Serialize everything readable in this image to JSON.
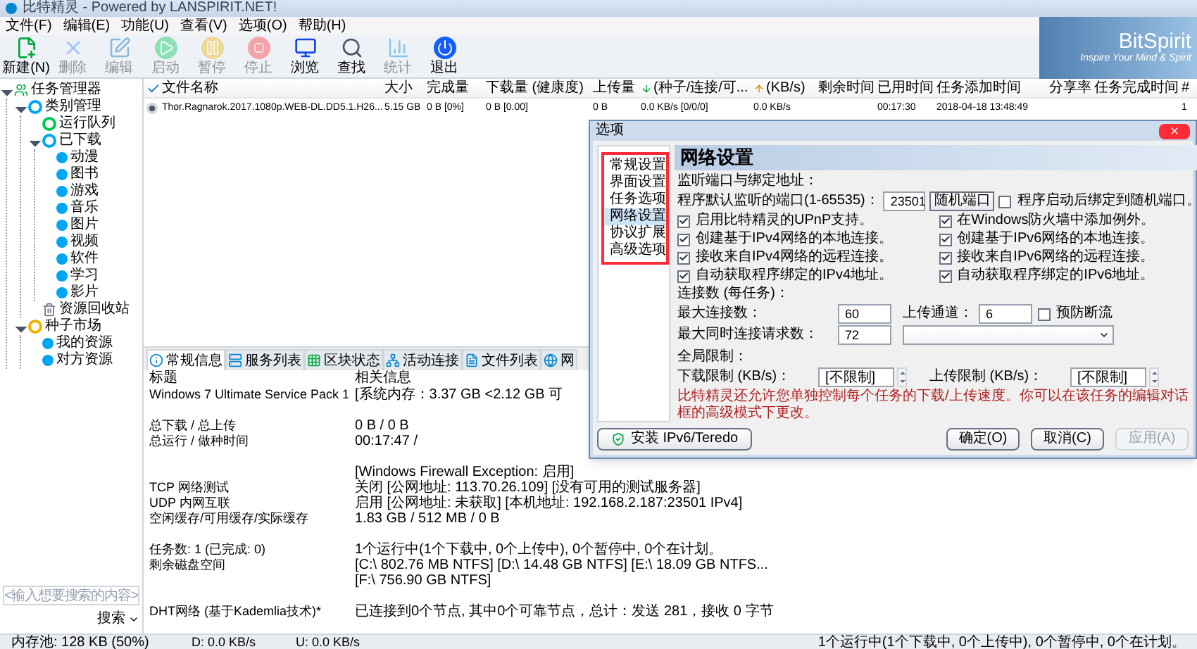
{
  "window": {
    "title": "比特精灵 - Powered by LANSPIRIT.NET!"
  },
  "menu": [
    "文件(F)",
    "编辑(E)",
    "功能(U)",
    "查看(V)",
    "选项(O)",
    "帮助(H)"
  ],
  "toolbar": [
    {
      "label": "新建(N)",
      "kind": "new",
      "disabled": false
    },
    {
      "label": "删除",
      "kind": "delete",
      "disabled": true
    },
    {
      "label": "编辑",
      "kind": "edit",
      "disabled": true
    },
    {
      "label": "启动",
      "kind": "start",
      "disabled": true
    },
    {
      "label": "暂停",
      "kind": "pause",
      "disabled": true
    },
    {
      "label": "停止",
      "kind": "stop",
      "disabled": true
    },
    {
      "label": "浏览",
      "kind": "browse",
      "disabled": false
    },
    {
      "label": "查找",
      "kind": "find",
      "disabled": false
    },
    {
      "label": "统计",
      "kind": "stats",
      "disabled": true
    },
    {
      "label": "退出",
      "kind": "exit",
      "disabled": false
    }
  ],
  "logo": {
    "name": "BitSpirit",
    "tagline": "Inspire Your Mind & Spirit"
  },
  "sidebar": {
    "tree": [
      {
        "label": "任务管理器",
        "kind": "manager",
        "expanded": true,
        "children": [
          {
            "label": "类别管理",
            "kind": "category",
            "expanded": true,
            "children": [
              {
                "label": "运行队列",
                "kind": "queue"
              },
              {
                "label": "已下载",
                "kind": "category",
                "expanded": true,
                "children": [
                  {
                    "label": "动漫",
                    "kind": "item"
                  },
                  {
                    "label": "图书",
                    "kind": "item"
                  },
                  {
                    "label": "游戏",
                    "kind": "item"
                  },
                  {
                    "label": "音乐",
                    "kind": "item"
                  },
                  {
                    "label": "图片",
                    "kind": "item"
                  },
                  {
                    "label": "视频",
                    "kind": "item"
                  },
                  {
                    "label": "软件",
                    "kind": "item"
                  },
                  {
                    "label": "学习",
                    "kind": "item"
                  },
                  {
                    "label": "影片",
                    "kind": "item"
                  }
                ]
              },
              {
                "label": "资源回收站",
                "kind": "recycle"
              }
            ]
          },
          {
            "label": "种子市场",
            "kind": "market",
            "expanded": true,
            "children": [
              {
                "label": "我的资源",
                "kind": "item"
              },
              {
                "label": "对方资源",
                "kind": "item"
              }
            ]
          }
        ]
      }
    ],
    "search": {
      "placeholder": "<输入想要搜索的内容>"
    },
    "search_button": "搜索"
  },
  "table": {
    "columns": [
      {
        "kind": "check"
      },
      {
        "label": "文件名称"
      },
      {
        "label": "大小"
      },
      {
        "label": "完成量"
      },
      {
        "label": "下载量 (健康度)"
      },
      {
        "label": "上传量"
      },
      {
        "label": "(种子/连接/可...",
        "kind": "down"
      },
      {
        "label": "(KB/s)",
        "kind": "up"
      },
      {
        "label": "剩余时间"
      },
      {
        "label": "已用时间"
      },
      {
        "label": "任务添加时间"
      },
      {
        "label": "分享率"
      },
      {
        "label": "任务完成时间"
      },
      {
        "label": "#"
      }
    ],
    "rows": [
      {
        "cells": [
          "",
          "Thor.Ragnarok.2017.1080p.WEB-DL.DD5.1.H26...",
          "5.15 GB",
          "0 B [0%]",
          "0 B [0.00]",
          "0 B",
          "0.0 KB/s [0/0/0]",
          "0.0 KB/s",
          null,
          "00:17:30",
          "2018-04-18 13:48:49",
          null,
          null,
          "1"
        ]
      }
    ]
  },
  "bottom_tabs": [
    {
      "label": "常规信息",
      "kind": "info",
      "selected": true
    },
    {
      "label": "服务列表",
      "kind": "server",
      "selected": false
    },
    {
      "label": "区块状态",
      "kind": "blocks",
      "selected": false
    },
    {
      "label": "活动连接",
      "kind": "network",
      "selected": false
    },
    {
      "label": "文件列表",
      "kind": "files",
      "selected": false
    },
    {
      "label": "网",
      "kind": "web",
      "selected": false
    }
  ],
  "info": {
    "columns": [
      "标题",
      "相关信息"
    ],
    "groups": [
      [
        {
          "label": "Windows 7 Ultimate Service Pack 1",
          "value": "[系统内存：3.37 GB <2.12 GB 可"
        }
      ],
      [
        {
          "label": "总下载 / 总上传",
          "value": "0 B / 0 B"
        },
        {
          "label": "总运行 / 做种时间",
          "value": "00:17:47 /"
        }
      ],
      [
        {
          "value": "[Windows Firewall Exception: 启用]"
        },
        {
          "label": "TCP 网络测试",
          "value": "关闭 [公网地址: 113.70.26.109] [没有可用的测试服务器]"
        },
        {
          "label": "UDP 内网互联",
          "value": "启用 [公网地址: 未获取] [本机地址: 192.168.2.187:23501 IPv4]"
        },
        {
          "label": "空闲缓存/可用缓存/实际缓存",
          "value": "1.83 GB / 512 MB / 0 B"
        }
      ],
      [
        {
          "label": "任务数: 1 (已完成: 0)",
          "value": "1个运行中(1个下载中, 0个上传中), 0个暂停中, 0个在计划。"
        },
        {
          "label": "剩余磁盘空间",
          "value": "[C:\\ 802.76 MB  NTFS]  [D:\\ 14.48 GB  NTFS]  [E:\\ 18.09 GB  NTFS..."
        },
        {
          "value": "[F:\\ 756.90 GB  NTFS]"
        }
      ],
      [
        {
          "label": "DHT网络 (基于Kademlia技术)*",
          "value": "已连接到0个节点, 其中0个可靠节点，总计：发送 281，接收 0 字节"
        }
      ]
    ]
  },
  "dialog": {
    "title": "选项",
    "nav": [
      {
        "label": "常规设置",
        "selected": false
      },
      {
        "label": "界面设置",
        "selected": false
      },
      {
        "label": "任务选项",
        "selected": false
      },
      {
        "label": "网络设置",
        "selected": true
      },
      {
        "label": "协议扩展",
        "selected": false
      },
      {
        "label": "高级选项",
        "selected": false
      }
    ],
    "heading": "网络设置",
    "listen_section": "监听端口与绑定地址：",
    "port_label": "程序默认监听的端口(1-65535)：",
    "port": "23501",
    "random_port_button": "随机端口",
    "random_on_start": {
      "label": "程序启动后绑定到随机端口。",
      "checked": false
    },
    "options": [
      {
        "label": "启用比特精灵的UPnP支持。",
        "checked": true
      },
      {
        "label": "在Windows防火墙中添加例外。",
        "checked": true
      },
      {
        "label": "创建基于IPv4网络的本地连接。",
        "checked": true
      },
      {
        "label": "创建基于IPv6网络的本地连接。",
        "checked": true
      },
      {
        "label": "接收来自IPv4网络的远程连接。",
        "checked": true
      },
      {
        "label": "接收来自IPv6网络的远程连接。",
        "checked": true
      },
      {
        "label": "自动获取程序绑定的IPv4地址。",
        "checked": true
      },
      {
        "label": "自动获取程序绑定的IPv6地址。",
        "checked": true
      }
    ],
    "conn_section": "连接数 (每任务)：",
    "max_conn_label": "最大连接数：",
    "max_conn": "60",
    "upload_slots_label": "上传通道：",
    "upload_slots": "6",
    "prevent_drop": {
      "label": "预防断流",
      "checked": false
    },
    "max_requests_label": "最大同时连接请求数：",
    "max_requests": "72",
    "global_section": "全局限制：",
    "down_limit_label": "下载限制 (KB/s)：",
    "down_limit": "[不限制]",
    "up_limit_label": "上传限制 (KB/s)：",
    "up_limit": "[不限制]",
    "note": "比特精灵还允许您单独控制每个任务的下载/上传速度。你可以在该任务的编辑对话框的高级模式下更改。",
    "ipv6_button": "安装 IPv6/Teredo",
    "ok": {
      "label": "确定(O)",
      "disabled": false
    },
    "cancel": {
      "label": "取消(C)",
      "disabled": false
    },
    "apply": {
      "label": "应用(A)",
      "disabled": true
    }
  },
  "status_bar": {
    "memory": "内存池: 128 KB (50%)",
    "down": "D: 0.0 KB/s",
    "up": "U: 0.0 KB/s",
    "tasks": "1个运行中(1个下载中, 0个上传中), 0个暂停中, 0个在计划。"
  }
}
